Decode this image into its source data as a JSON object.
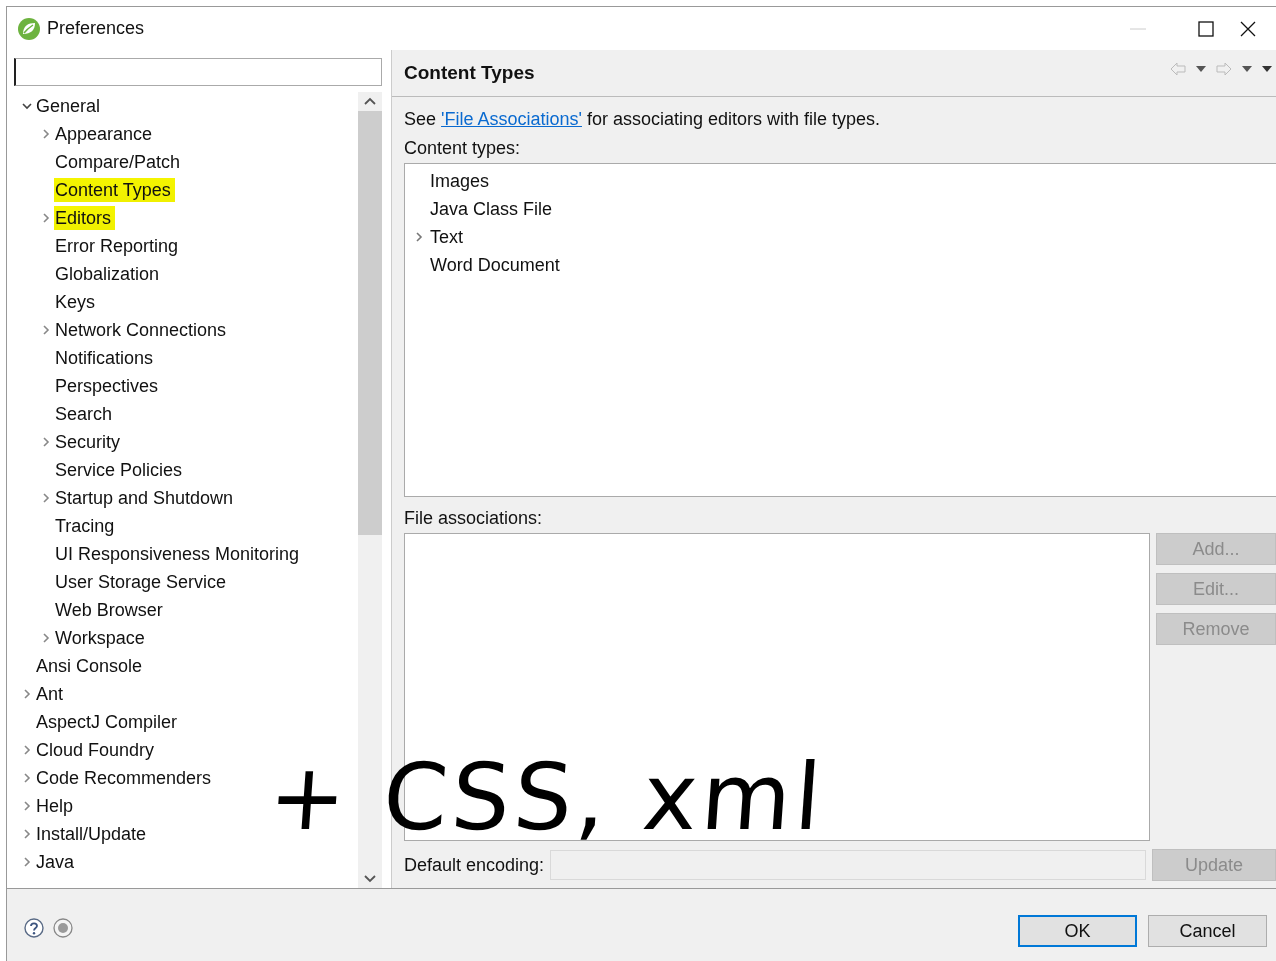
{
  "window": {
    "title": "Preferences"
  },
  "tree": [
    {
      "label": "General",
      "kind": "group",
      "expanded": true,
      "selected": false,
      "highlighted": false,
      "children": [
        {
          "label": "Appearance",
          "kind": "group",
          "expanded": false,
          "selected": false,
          "highlighted": false
        },
        {
          "label": "Compare/Patch",
          "kind": "page",
          "selected": false,
          "highlighted": false
        },
        {
          "label": "Content Types",
          "kind": "page",
          "selected": true,
          "highlighted": true
        },
        {
          "label": "Editors",
          "kind": "group",
          "expanded": false,
          "selected": false,
          "highlighted": true
        },
        {
          "label": "Error Reporting",
          "kind": "page",
          "selected": false,
          "highlighted": false
        },
        {
          "label": "Globalization",
          "kind": "page",
          "selected": false,
          "highlighted": false
        },
        {
          "label": "Keys",
          "kind": "page",
          "selected": false,
          "highlighted": false
        },
        {
          "label": "Network Connections",
          "kind": "group",
          "expanded": false,
          "selected": false,
          "highlighted": false
        },
        {
          "label": "Notifications",
          "kind": "page",
          "selected": false,
          "highlighted": false
        },
        {
          "label": "Perspectives",
          "kind": "page",
          "selected": false,
          "highlighted": false
        },
        {
          "label": "Search",
          "kind": "page",
          "selected": false,
          "highlighted": false
        },
        {
          "label": "Security",
          "kind": "group",
          "expanded": false,
          "selected": false,
          "highlighted": false
        },
        {
          "label": "Service Policies",
          "kind": "page",
          "selected": false,
          "highlighted": false
        },
        {
          "label": "Startup and Shutdown",
          "kind": "group",
          "expanded": false,
          "selected": false,
          "highlighted": false
        },
        {
          "label": "Tracing",
          "kind": "page",
          "selected": false,
          "highlighted": false
        },
        {
          "label": "UI Responsiveness Monitoring",
          "kind": "page",
          "selected": false,
          "highlighted": false
        },
        {
          "label": "User Storage Service",
          "kind": "page",
          "selected": false,
          "highlighted": false
        },
        {
          "label": "Web Browser",
          "kind": "page",
          "selected": false,
          "highlighted": false
        },
        {
          "label": "Workspace",
          "kind": "group",
          "expanded": false,
          "selected": false,
          "highlighted": false
        }
      ]
    },
    {
      "label": "Ansi Console",
      "kind": "page",
      "selected": false,
      "highlighted": false
    },
    {
      "label": "Ant",
      "kind": "group",
      "expanded": false,
      "selected": false,
      "highlighted": false
    },
    {
      "label": "AspectJ Compiler",
      "kind": "page",
      "selected": false,
      "highlighted": false
    },
    {
      "label": "Cloud Foundry",
      "kind": "group",
      "expanded": false,
      "selected": false,
      "highlighted": false
    },
    {
      "label": "Code Recommenders",
      "kind": "group",
      "expanded": false,
      "selected": false,
      "highlighted": false
    },
    {
      "label": "Help",
      "kind": "group",
      "expanded": false,
      "selected": false,
      "highlighted": false
    },
    {
      "label": "Install/Update",
      "kind": "group",
      "expanded": false,
      "selected": false,
      "highlighted": false
    },
    {
      "label": "Java",
      "kind": "group",
      "expanded": false,
      "selected": false,
      "highlighted": false
    }
  ],
  "page": {
    "title": "Content Types",
    "intro": {
      "before": "See ",
      "link": "'File Associations'",
      "after": " for associating editors with file types."
    },
    "content_types_label": "Content types:",
    "content_types": [
      {
        "label": "Images",
        "kind": "page"
      },
      {
        "label": "Java Class File",
        "kind": "page"
      },
      {
        "label": "Text",
        "kind": "group",
        "expanded": false
      },
      {
        "label": "Word Document",
        "kind": "page"
      }
    ],
    "file_associations_label": "File associations:",
    "side_buttons": [
      {
        "label": "Add...",
        "disabled": true
      },
      {
        "label": "Edit...",
        "disabled": true
      },
      {
        "label": "Remove",
        "disabled": true
      }
    ],
    "encoding": {
      "label": "Default encoding:",
      "disabled": true
    },
    "update_button": {
      "label": "Update",
      "disabled": true
    }
  },
  "buttons": [
    {
      "label": "OK",
      "default": true
    },
    {
      "label": "Cancel",
      "default": false
    }
  ],
  "annotation": {
    "text": "+ CSS, xml"
  }
}
